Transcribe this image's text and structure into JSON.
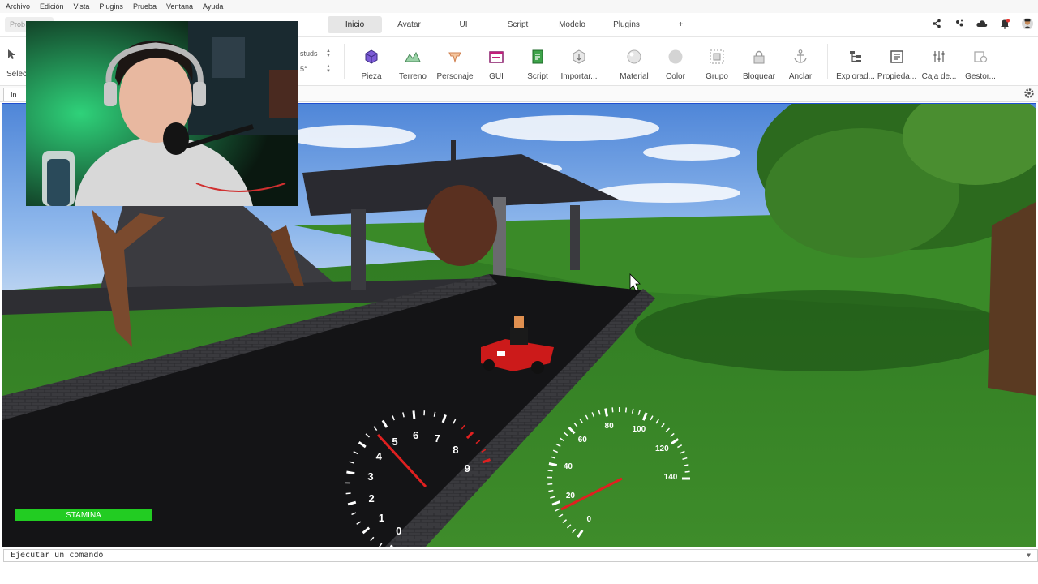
{
  "menu": [
    "Archivo",
    "Edición",
    "Vista",
    "Plugins",
    "Prueba",
    "Ventana",
    "Ayuda"
  ],
  "project_box_text": "Prob",
  "tabs": [
    {
      "label": "Inicio",
      "active": true
    },
    {
      "label": "Avatar",
      "active": false
    },
    {
      "label": "UI",
      "active": false
    },
    {
      "label": "Script",
      "active": false
    },
    {
      "label": "Modelo",
      "active": false
    },
    {
      "label": "Plugins",
      "active": false
    },
    {
      "label": "+",
      "active": false
    }
  ],
  "top_icons": [
    "share-icon",
    "collaborate-icon",
    "cloud-icon",
    "notification-icon",
    "avatar-icon"
  ],
  "ribbon": {
    "select_label": "Selec",
    "move_studs": "studs",
    "rotate_deg": "5°",
    "home_tools": [
      {
        "label": "Pieza",
        "icon": "part-cube-icon"
      },
      {
        "label": "Terreno",
        "icon": "terrain-icon"
      },
      {
        "label": "Personaje",
        "icon": "character-icon"
      },
      {
        "label": "GUI",
        "icon": "gui-icon"
      },
      {
        "label": "Script",
        "icon": "script-icon"
      },
      {
        "label": "Importar...",
        "icon": "import-icon"
      }
    ],
    "edit_tools": [
      {
        "label": "Material",
        "icon": "material-icon"
      },
      {
        "label": "Color",
        "icon": "color-icon"
      },
      {
        "label": "Grupo",
        "icon": "group-icon"
      },
      {
        "label": "Bloquear",
        "icon": "lock-icon"
      },
      {
        "label": "Anclar",
        "icon": "anchor-icon"
      }
    ],
    "panel_tools": [
      {
        "label": "Explorad...",
        "icon": "explorer-icon"
      },
      {
        "label": "Propieda...",
        "icon": "properties-icon"
      },
      {
        "label": "Caja de...",
        "icon": "toolbox-icon"
      },
      {
        "label": "Gestor...",
        "icon": "asset-manager-icon"
      }
    ]
  },
  "doc_tab_label": "In",
  "hud": {
    "stamina_label": "STAMINA",
    "tachometer_ticks": [
      "0",
      "1",
      "2",
      "3",
      "4",
      "5",
      "6",
      "7",
      "8",
      "9"
    ],
    "speedometer_ticks": [
      "0",
      "20",
      "40",
      "60",
      "80",
      "100",
      "120",
      "140"
    ]
  },
  "command_bar": {
    "placeholder": "Ejecutar un comando"
  },
  "colors": {
    "viewport_border": "#1f4fd0",
    "stamina_bar": "#22cc22",
    "needle": "#e02020"
  }
}
